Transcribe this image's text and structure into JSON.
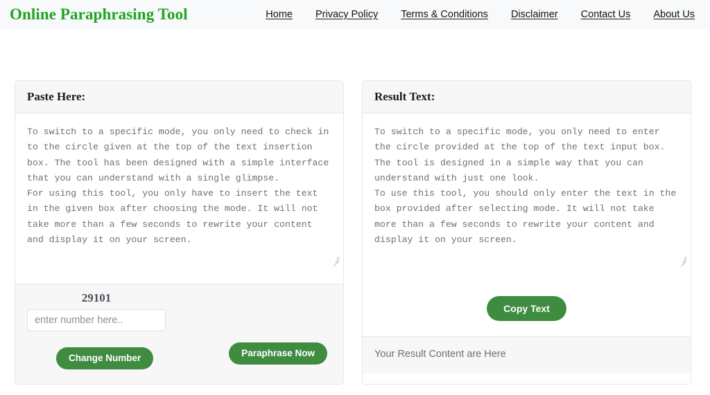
{
  "navbar": {
    "brand": "Online Paraphrasing Tool",
    "links": [
      {
        "label": "Home"
      },
      {
        "label": "Privacy Policy"
      },
      {
        "label": "Terms & Conditions"
      },
      {
        "label": "Disclaimer"
      },
      {
        "label": "Contact Us"
      },
      {
        "label": "About Us"
      }
    ]
  },
  "colors": {
    "brand_green": "#1fa520",
    "button_green": "#3f8c41",
    "panel_header_bg": "#f7f7f8",
    "border": "#e6e6e6",
    "body_text": "#6a7179"
  },
  "left_panel": {
    "title": "Paste Here:",
    "textarea": {
      "name": "paste-textarea",
      "value": "To switch to a specific mode, you only need to check in to the circle given at the top of the text insertion box. The tool has been designed with a simple interface that you can understand with a single glimpse.\nFor using this tool, you only have to insert the text in the given box after choosing the mode. It will not take more than a few seconds to rewrite your content and display it on your screen."
    },
    "counter": "29101",
    "number_input": {
      "value": "",
      "placeholder": "enter number here.."
    },
    "change_number_button": "Change Number",
    "paraphrase_button": "Paraphrase Now"
  },
  "right_panel": {
    "title": "Result Text:",
    "textarea": {
      "name": "result-textarea",
      "value": "To switch to a specific mode, you only need to enter the circle provided at the top of the text input box. The tool is designed in a simple way that you can understand with just one look.\nTo use this tool, you should only enter the text in the box provided after selecting mode. It will not take more than a few seconds to rewrite your content and display it on your screen."
    },
    "copy_button": "Copy Text",
    "result_note": "Your Result Content are Here"
  },
  "icons": {
    "resize_grip": "resize-grip-icon"
  }
}
